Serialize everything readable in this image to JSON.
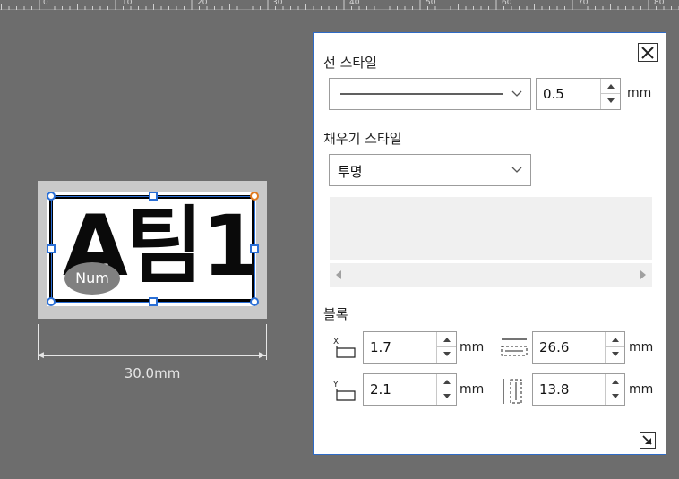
{
  "ruler": {
    "labels": [
      "0",
      "10",
      "20",
      "30",
      "40",
      "50",
      "60",
      "70",
      "80"
    ]
  },
  "label": {
    "text": "A팀1",
    "badge": "Num",
    "width_text": "30.0mm"
  },
  "panel": {
    "line_style": {
      "title": "선 스타일",
      "width_value": "0.5",
      "unit": "mm"
    },
    "fill_style": {
      "title": "채우기 스타일",
      "selected": "투명"
    },
    "block": {
      "title": "블록",
      "x_label": "X",
      "x_value": "1.7",
      "x_unit": "mm",
      "y_label": "Y",
      "y_value": "2.1",
      "y_unit": "mm",
      "w_value": "26.6",
      "w_unit": "mm",
      "h_value": "13.8",
      "h_unit": "mm"
    }
  },
  "colors": {
    "accent": "#2a6fd6",
    "rotate_handle": "#e07a1f",
    "workspace": "#6d6d6d",
    "panel_border": "#2e6bc6"
  },
  "icons": [
    "close-icon",
    "chevron-down-icon",
    "spin-up-icon",
    "spin-down-icon",
    "scroll-left-icon",
    "scroll-right-icon",
    "x-position-icon",
    "y-position-icon",
    "width-icon",
    "height-icon",
    "resize-grip-icon"
  ]
}
